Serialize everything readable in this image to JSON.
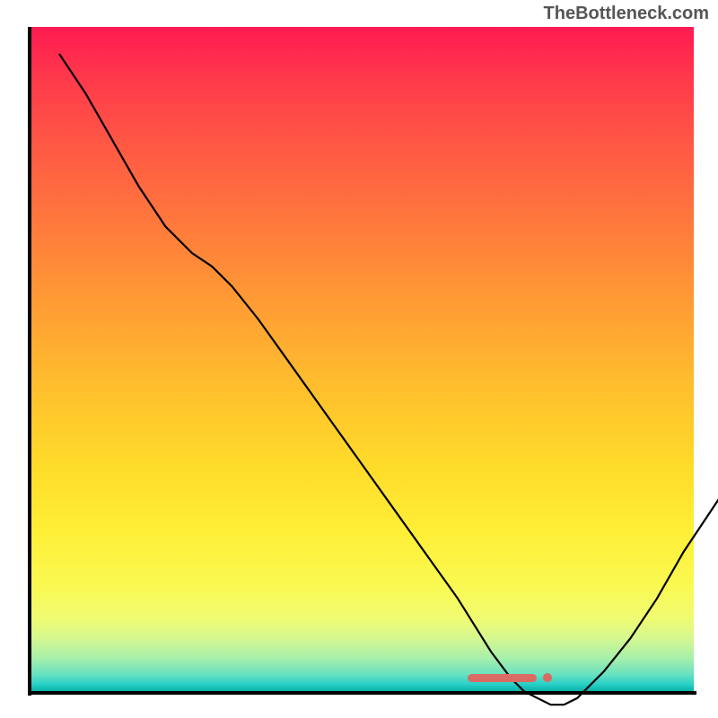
{
  "watermark": "TheBottleneck.com",
  "chart_data": {
    "type": "line",
    "title": "",
    "xlabel": "",
    "ylabel": "",
    "x": [
      0.0,
      0.04,
      0.08,
      0.12,
      0.16,
      0.2,
      0.23,
      0.26,
      0.3,
      0.35,
      0.4,
      0.45,
      0.5,
      0.55,
      0.6,
      0.65,
      0.68,
      0.7,
      0.72,
      0.74,
      0.76,
      0.78,
      0.82,
      0.86,
      0.9,
      0.94,
      0.98,
      1.0
    ],
    "values": [
      1.0,
      0.94,
      0.87,
      0.8,
      0.74,
      0.7,
      0.68,
      0.65,
      0.6,
      0.53,
      0.46,
      0.39,
      0.32,
      0.25,
      0.18,
      0.1,
      0.06,
      0.04,
      0.03,
      0.02,
      0.02,
      0.03,
      0.07,
      0.12,
      0.18,
      0.25,
      0.31,
      0.34
    ],
    "xlim": [
      0,
      1
    ],
    "ylim": [
      0,
      1
    ],
    "background_gradient": {
      "orientation": "vertical",
      "stops": [
        {
          "pos": 0.0,
          "color": "#ff1a51"
        },
        {
          "pos": 0.5,
          "color": "#ffbe2d"
        },
        {
          "pos": 0.84,
          "color": "#faf951"
        },
        {
          "pos": 1.0,
          "color": "#09b2a9"
        }
      ]
    },
    "marker": {
      "x_start": 0.66,
      "x_end": 0.78,
      "y": 0.02,
      "color": "#d96b63"
    }
  }
}
